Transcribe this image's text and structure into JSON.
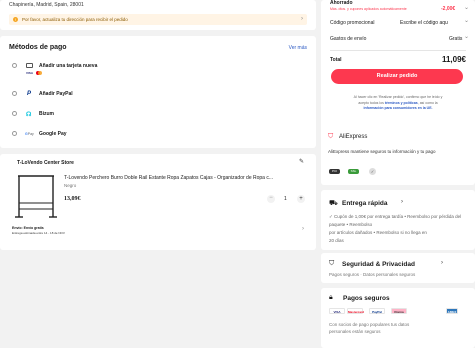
{
  "address": {
    "text": "Chapinería, Madrid, Spain, 28001",
    "notice": "Por favor, actualiza tu dirección para recibir el pedido"
  },
  "payment": {
    "title": "Métodos de pago",
    "see_more": "Ver más",
    "methods": [
      {
        "label": "Añadir una tarjeta nueva",
        "icon": "credit-card-icon"
      },
      {
        "label": "Añadir PayPal",
        "icon": "paypal-icon"
      },
      {
        "label": "Bizum",
        "icon": "bizum-icon"
      },
      {
        "label": "Google Pay",
        "icon": "google-pay-icon"
      }
    ],
    "card_brands": [
      "VISA",
      "MC"
    ]
  },
  "store": {
    "name": "T-LoVendo Center Store",
    "product_title": "T-Lovendo Perchero Burro Doble Rail Estante Ropa Zapatos Cajas - Organizador de Ropa c...",
    "color": "Negro",
    "price": "13,09€",
    "quantity": "1",
    "shipping_label": "Envío: Envío gratis",
    "delivery": "Entrega estimada entre 14 - 18 de NOV"
  },
  "summary": {
    "saved_label": "Ahorrado",
    "saved_sub": "Más. dtos. y cupones aplicados automáticamente",
    "saved_value": "-2,00€",
    "promo_label": "Código promocional",
    "promo_value": "Escribe el código aqu",
    "shipping_label": "Gastos de envío",
    "shipping_value": "Gratis",
    "total_label": "Total",
    "total_value": "11,09€",
    "button": "Realizar pedido",
    "terms_1": "Al hacer clic en 'Realizar pedido', confirmo que he leído y",
    "terms_2": "acepto todos los",
    "terms_link1": "términos y políticas",
    "terms_3": ", así como la",
    "terms_link2": "información para consumidores en la UE."
  },
  "trust": {
    "brand": "AliExpress",
    "text": "AliExpress mantiene seguros tu información y tu pago",
    "badges": [
      "PCI",
      "SSL",
      "✓"
    ]
  },
  "features": [
    {
      "title": "Entrega rápida",
      "icon": "truck-icon",
      "lines": [
        "✓ Cupón de 1,00€ por entrega tardía  •  Reembolso por pérdida del paquete  •  Reembolso",
        "por artículos dañados  •  Reembolso si no llega en",
        "20 días"
      ]
    },
    {
      "title": "Seguridad & Privacidad",
      "icon": "shield-icon",
      "lines": [
        "Pagos seguros · Datos personales seguros"
      ]
    },
    {
      "title": "Pagos seguros",
      "icon": "lock-icon",
      "logos": [
        "VISA",
        "Mastercard",
        "PayPal",
        "Klarna",
        "AMEX"
      ],
      "lines": [
        "Con socios de pago populares tus datos",
        "personales están seguros"
      ]
    }
  ],
  "colors": {
    "accent": "#fd384f",
    "link": "#2e5bc4",
    "bg": "#f2f2f2"
  }
}
